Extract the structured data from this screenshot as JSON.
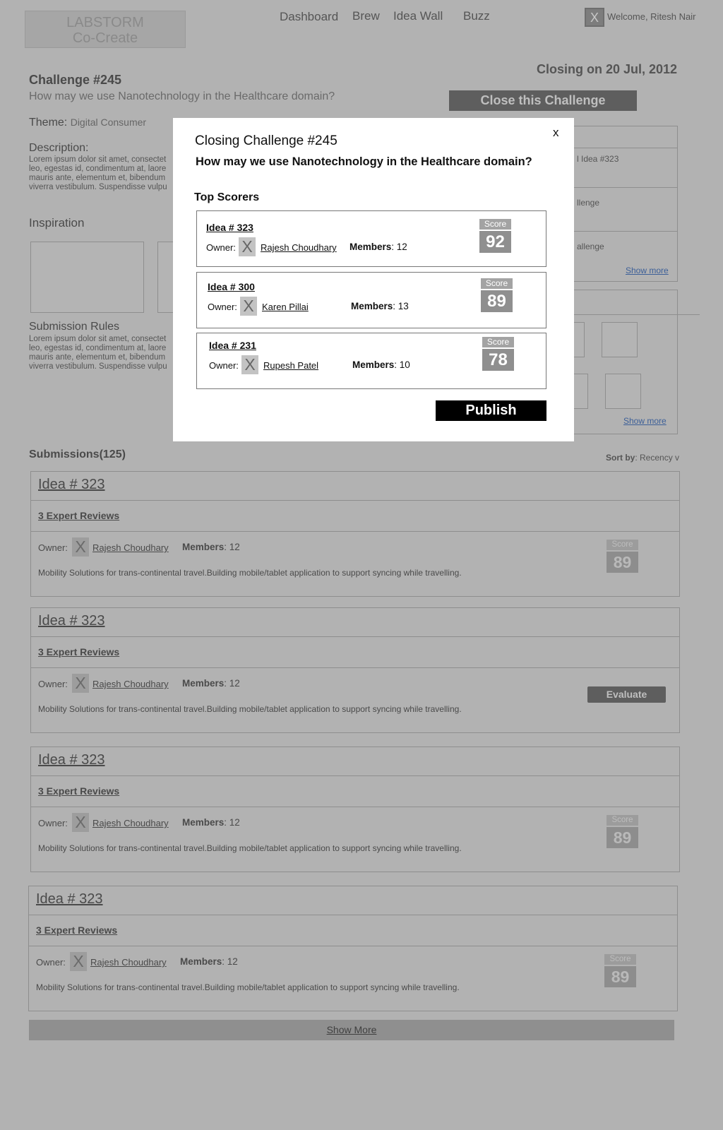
{
  "header": {
    "logo_line1": "LABSTORM",
    "logo_line2": "Co-Create",
    "nav": [
      "Dashboard",
      "Brew",
      "Idea Wall",
      "Buzz"
    ],
    "avatar_glyph": "X",
    "welcome": "Welcome, Ritesh Nair"
  },
  "challenge": {
    "id": "Challenge #245",
    "question": "How may we use Nanotechnology in the Healthcare domain?",
    "closing": "Closing on 20 Jul, 2012",
    "close_button": "Close this Challenge",
    "theme_label": "Theme:",
    "theme_value": "Digital Consumer",
    "description_title": "Description:",
    "description_lines": [
      "Lorem ipsum dolor sit amet, consectet",
      "leo, egestas id, condimentum at, laore",
      "mauris ante, elementum et, bibendum",
      "viverra vestibulum. Suspendisse vulpu"
    ],
    "inspiration_title": "Inspiration",
    "rules_title": "Submission Rules",
    "rules_lines": [
      "Lorem ipsum dolor sit amet, consectet",
      "leo, egestas id, condimentum at, laore",
      "mauris ante, elementum et, bibendum",
      "viverra vestibulum. Suspendisse vulpu"
    ]
  },
  "side": {
    "items": [
      "l Idea #323",
      "llenge",
      "allenge"
    ],
    "show_more_1": "Show more",
    "show_more_2": "Show more"
  },
  "submissions": {
    "title": "Submissions(125)",
    "sort_label": "Sort by",
    "sort_value": "Recency v",
    "show_more": "Show More",
    "owner_label": "Owner:",
    "members_label": "Members",
    "score_label": "Score",
    "evaluate": "Evaluate",
    "cards": [
      {
        "title": "Idea # 323",
        "reviews": "3 Expert Reviews",
        "owner": "Rajesh Choudhary",
        "members": "12",
        "desc": "Mobility Solutions for trans-continental travel.Building mobile/tablet application to support syncing while travelling.",
        "score": "89"
      },
      {
        "title": "Idea # 323",
        "reviews": "3 Expert Reviews",
        "owner": "Rajesh Choudhary",
        "members": "12",
        "desc": "Mobility Solutions for trans-continental travel.Building mobile/tablet application to support syncing while travelling."
      },
      {
        "title": "Idea # 323",
        "reviews": "3 Expert Reviews",
        "owner": "Rajesh Choudhary",
        "members": "12",
        "desc": "Mobility Solutions for trans-continental travel.Building mobile/tablet application to support syncing while travelling.",
        "score": "89"
      },
      {
        "title": "Idea # 323",
        "reviews": "3 Expert Reviews",
        "owner": "Rajesh Choudhary",
        "members": "12",
        "desc": "Mobility Solutions for trans-continental travel.Building mobile/tablet application to support syncing while travelling.",
        "score": "89"
      }
    ]
  },
  "modal": {
    "title": "Closing Challenge #245",
    "question": "How may we use Nanotechnology in the Healthcare domain?",
    "close": "x",
    "top_scorers": "Top Scorers",
    "owner_label": "Owner:",
    "members_label": "Members",
    "score_label": "Score",
    "publish": "Publish",
    "scorers": [
      {
        "idea": "Idea # 323",
        "owner": "Rajesh Choudhary",
        "members": "12",
        "score": "92"
      },
      {
        "idea": "Idea # 300",
        "owner": "Karen Pillai",
        "members": "13",
        "score": "89"
      },
      {
        "idea": "Idea # 231",
        "owner": "Rupesh Patel",
        "members": "10",
        "score": "78"
      }
    ]
  }
}
